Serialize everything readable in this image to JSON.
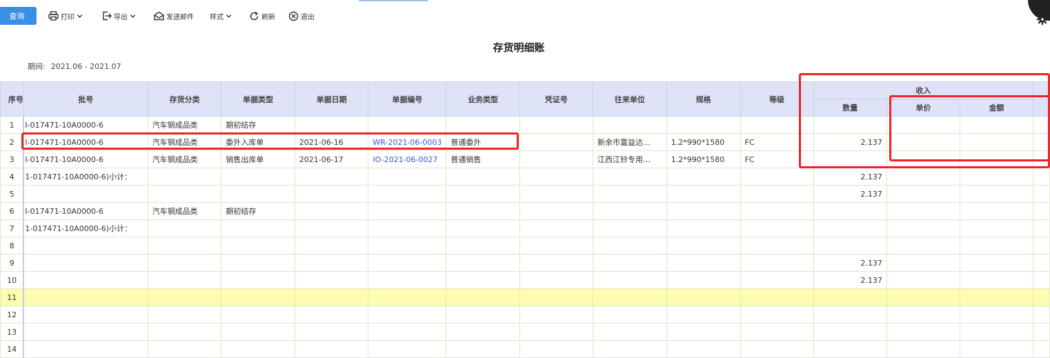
{
  "toolbar": {
    "query": "查询",
    "print": "打印",
    "export": "导出",
    "send_mail": "发送邮件",
    "style": "样式",
    "refresh": "刷新",
    "exit": "退出"
  },
  "report": {
    "title": "存货明细账",
    "period_label": "期间:",
    "period_value": "2021.06 - 2021.07"
  },
  "table": {
    "headers": {
      "idx": "序号",
      "batch": "批号",
      "category": "存货分类",
      "doc_type": "单据类型",
      "doc_date": "单据日期",
      "doc_no": "单据编号",
      "biz_type": "业务类型",
      "voucher": "凭证号",
      "partner": "往来单位",
      "spec": "规格",
      "grade": "等级",
      "income": "收入",
      "qty": "数量",
      "unit_price": "单价",
      "amount": "金额"
    },
    "rows": [
      {
        "idx": "1",
        "batch": "I-017471-10A0000-6",
        "category": "汽车钢成品类",
        "doc_type": "期初结存",
        "doc_date": "",
        "doc_no": "",
        "biz_type": "",
        "voucher": "",
        "partner": "",
        "spec": "",
        "grade": "",
        "qty": "",
        "unit_price": "",
        "amount": ""
      },
      {
        "idx": "2",
        "batch": "I-017471-10A0000-6",
        "category": "汽车钢成品类",
        "doc_type": "委外入库单",
        "doc_date": "2021-06-16",
        "doc_no": "WR-2021-06-0003",
        "biz_type": "普通委外",
        "voucher": "",
        "partner": "新余市富益达…",
        "spec": "1.2*990*1580",
        "grade": "FC",
        "qty": "2.137",
        "unit_price": "",
        "amount": ""
      },
      {
        "idx": "3",
        "batch": "I-017471-10A0000-6",
        "category": "汽车钢成品类",
        "doc_type": "销售出库单",
        "doc_date": "2021-06-17",
        "doc_no": "IO-2021-06-0027",
        "biz_type": "普通销售",
        "voucher": "",
        "partner": "江西江铃专用…",
        "spec": "1.2*990*1580",
        "grade": "FC",
        "qty": "",
        "unit_price": "",
        "amount": ""
      },
      {
        "idx": "4",
        "batch": "1-017471-10A0000-6)小计：",
        "category": "",
        "doc_type": "",
        "doc_date": "",
        "doc_no": "",
        "biz_type": "",
        "voucher": "",
        "partner": "",
        "spec": "",
        "grade": "",
        "qty": "2.137",
        "unit_price": "",
        "amount": ""
      },
      {
        "idx": "5",
        "batch": "",
        "category": "",
        "doc_type": "",
        "doc_date": "",
        "doc_no": "",
        "biz_type": "",
        "voucher": "",
        "partner": "",
        "spec": "",
        "grade": "",
        "qty": "2.137",
        "unit_price": "",
        "amount": ""
      },
      {
        "idx": "6",
        "batch": "I-017471-10A0000-6",
        "category": "汽车钢成品类",
        "doc_type": "期初结存",
        "doc_date": "",
        "doc_no": "",
        "biz_type": "",
        "voucher": "",
        "partner": "",
        "spec": "",
        "grade": "",
        "qty": "",
        "unit_price": "",
        "amount": ""
      },
      {
        "idx": "7",
        "batch": "1-017471-10A0000-6)小计：",
        "category": "",
        "doc_type": "",
        "doc_date": "",
        "doc_no": "",
        "biz_type": "",
        "voucher": "",
        "partner": "",
        "spec": "",
        "grade": "",
        "qty": "",
        "unit_price": "",
        "amount": ""
      },
      {
        "idx": "8",
        "batch": "",
        "category": "",
        "doc_type": "",
        "doc_date": "",
        "doc_no": "",
        "biz_type": "",
        "voucher": "",
        "partner": "",
        "spec": "",
        "grade": "",
        "qty": "",
        "unit_price": "",
        "amount": ""
      },
      {
        "idx": "9",
        "batch": "",
        "category": "",
        "doc_type": "",
        "doc_date": "",
        "doc_no": "",
        "biz_type": "",
        "voucher": "",
        "partner": "",
        "spec": "",
        "grade": "",
        "qty": "2.137",
        "unit_price": "",
        "amount": ""
      },
      {
        "idx": "10",
        "batch": "",
        "category": "",
        "doc_type": "",
        "doc_date": "",
        "doc_no": "",
        "biz_type": "",
        "voucher": "",
        "partner": "",
        "spec": "",
        "grade": "",
        "qty": "2.137",
        "unit_price": "",
        "amount": ""
      },
      {
        "idx": "11",
        "batch": "",
        "category": "",
        "doc_type": "",
        "doc_date": "",
        "doc_no": "",
        "biz_type": "",
        "voucher": "",
        "partner": "",
        "spec": "",
        "grade": "",
        "qty": "",
        "unit_price": "",
        "amount": ""
      },
      {
        "idx": "12",
        "batch": "",
        "category": "",
        "doc_type": "",
        "doc_date": "",
        "doc_no": "",
        "biz_type": "",
        "voucher": "",
        "partner": "",
        "spec": "",
        "grade": "",
        "qty": "",
        "unit_price": "",
        "amount": ""
      },
      {
        "idx": "13",
        "batch": "",
        "category": "",
        "doc_type": "",
        "doc_date": "",
        "doc_no": "",
        "biz_type": "",
        "voucher": "",
        "partner": "",
        "spec": "",
        "grade": "",
        "qty": "",
        "unit_price": "",
        "amount": ""
      },
      {
        "idx": "14",
        "batch": "",
        "category": "",
        "doc_type": "",
        "doc_date": "",
        "doc_no": "",
        "biz_type": "",
        "voucher": "",
        "partner": "",
        "spec": "",
        "grade": "",
        "qty": "",
        "unit_price": "",
        "amount": ""
      }
    ],
    "highlight_row": "11",
    "link_color": "#3a56d4",
    "highlight_color": "#fefcb0",
    "header_color": "#dfe3f7"
  },
  "annotation_color": "#ee2222"
}
